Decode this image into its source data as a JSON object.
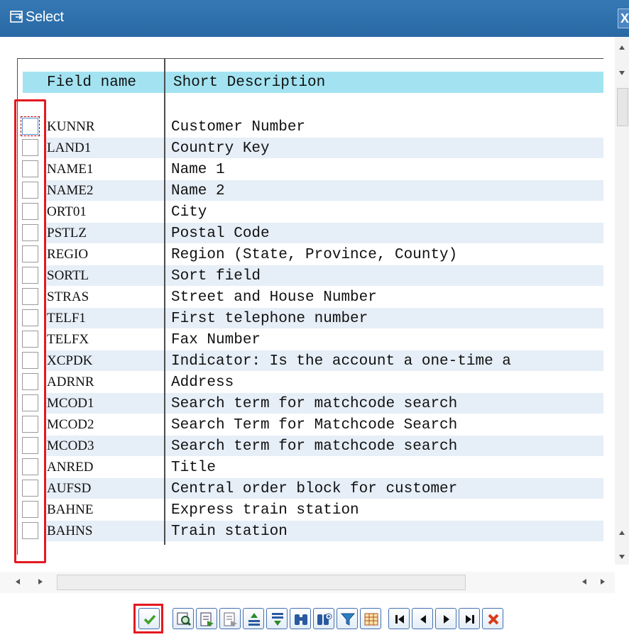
{
  "window": {
    "title": "Select",
    "close_label": "X"
  },
  "table": {
    "headers": {
      "field_name": "Field name",
      "short_description": "Short Description"
    },
    "rows": [
      {
        "field": "KUNNR",
        "desc": "Customer Number"
      },
      {
        "field": "LAND1",
        "desc": "Country Key"
      },
      {
        "field": "NAME1",
        "desc": "Name 1"
      },
      {
        "field": "NAME2",
        "desc": "Name 2"
      },
      {
        "field": "ORT01",
        "desc": "City"
      },
      {
        "field": "PSTLZ",
        "desc": "Postal Code"
      },
      {
        "field": "REGIO",
        "desc": "Region (State, Province, County)"
      },
      {
        "field": "SORTL",
        "desc": "Sort field"
      },
      {
        "field": "STRAS",
        "desc": "Street and House Number"
      },
      {
        "field": "TELF1",
        "desc": "First telephone number"
      },
      {
        "field": "TELFX",
        "desc": "Fax Number"
      },
      {
        "field": "XCPDK",
        "desc": "Indicator: Is the account a one-time a"
      },
      {
        "field": "ADRNR",
        "desc": "Address"
      },
      {
        "field": "MCOD1",
        "desc": "Search term for matchcode search"
      },
      {
        "field": "MCOD2",
        "desc": "Search Term for Matchcode Search"
      },
      {
        "field": "MCOD3",
        "desc": "Search term for matchcode search"
      },
      {
        "field": "ANRED",
        "desc": "Title"
      },
      {
        "field": "AUFSD",
        "desc": "Central order block for customer"
      },
      {
        "field": "BAHNE",
        "desc": "Express train station"
      },
      {
        "field": "BAHNS",
        "desc": "Train station"
      }
    ]
  },
  "toolbar": {
    "buttons": [
      "confirm-icon",
      "find-icon",
      "select-all-icon",
      "deselect-all-icon",
      "sort-ascending-icon",
      "sort-descending-icon",
      "find-binoculars-icon",
      "find-next-icon",
      "filter-icon",
      "layout-grid-icon",
      "first-page-icon",
      "previous-page-icon",
      "next-page-icon",
      "last-page-icon",
      "cancel-icon"
    ]
  },
  "colors": {
    "titlebar": "#2f72ae",
    "header_band": "#a3e3f1",
    "row_alt": "#e6eef7",
    "highlight": "#e4181f"
  }
}
